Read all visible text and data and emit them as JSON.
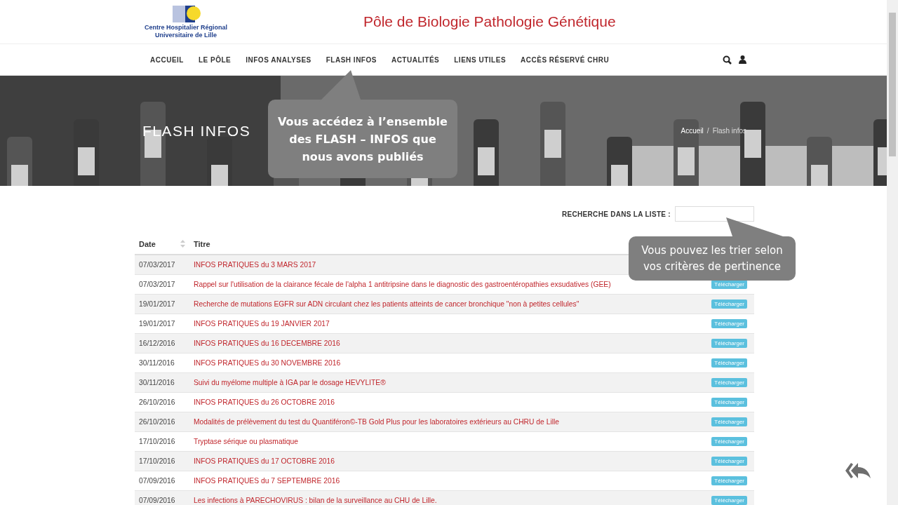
{
  "header": {
    "logo_lines": [
      "Centre Hospitalier Régional",
      "Universitaire de Lille"
    ],
    "site_title": "Pôle de Biologie Pathologie Génétique"
  },
  "nav": {
    "items": [
      "ACCUEIL",
      "LE PÔLE",
      "INFOS ANALYSES",
      "FLASH INFOS",
      "ACTUALITÉS",
      "LIENS UTILES",
      "ACCÈS RÉSERVÉ CHRU"
    ]
  },
  "hero": {
    "kind": "picture",
    "title": "FLASH INFOS",
    "breadcrumb": [
      "Accueil",
      "/",
      "Flash infos"
    ]
  },
  "search": {
    "label": "RECHERCHE DANS LA LISTE :"
  },
  "table": {
    "columns": [
      "Date",
      "Titre"
    ],
    "rows": [
      {
        "date": "07/03/2017",
        "title": "INFOS PRATIQUES du 3 MARS 2017"
      },
      {
        "date": "07/03/2017",
        "title": "Rappel sur l'utilisation de la clairance fécale de l'alpha 1 antitripsine dans le diagnostic des gastroentéropathies exsudatives (GEE)",
        "download": "Télécharger"
      },
      {
        "date": "19/01/2017",
        "title": "Recherche de mutations EGFR sur ADN circulant chez les patients atteints de cancer bronchique \"non à petites cellules\"",
        "download": "Télécharger"
      },
      {
        "date": "19/01/2017",
        "title": "INFOS PRATIQUES du 19 JANVIER 2017",
        "download": "Télécharger"
      },
      {
        "date": "16/12/2016",
        "title": "INFOS PRATIQUES du 16 DECEMBRE 2016",
        "download": "Télécharger"
      },
      {
        "date": "30/11/2016",
        "title": "INFOS PRATIQUES du 30 NOVEMBRE 2016",
        "download": "Télécharger"
      },
      {
        "date": "30/11/2016",
        "title": "Suivi du myélome multiple à IGA par le dosage HEVYLITE®",
        "download": "Télécharger"
      },
      {
        "date": "26/10/2016",
        "title": "INFOS PRATIQUES du 26 OCTOBRE 2016",
        "download": "Télécharger"
      },
      {
        "date": "26/10/2016",
        "title": "Modalités de prélèvement du test du Quantiféron©-TB Gold Plus pour les laboratoires extérieurs au CHRU de Lille",
        "download": "Télécharger"
      },
      {
        "date": "17/10/2016",
        "title": "Tryptase sérique ou plasmatique",
        "download": "Télécharger"
      },
      {
        "date": "17/10/2016",
        "title": "INFOS PRATIQUES du 17 OCTOBRE 2016",
        "download": "Télécharger"
      },
      {
        "date": "07/09/2016",
        "title": "INFOS PRATIQUES du 7 SEPTEMBRE 2016",
        "download": "Télécharger"
      },
      {
        "date": "07/09/2016",
        "title": "Les infections à PARECHOVIRUS : bilan de la surveillance au CHU de Lille.",
        "download": "Télécharger"
      }
    ]
  },
  "callouts": [
    {
      "text": "Vous accédez à l’ensemble des FLASH – INFOS que nous avons publiés",
      "bold": true
    },
    {
      "text": "Vous pouvez les trier selon vos critères de pertinence",
      "bold": false
    }
  ]
}
